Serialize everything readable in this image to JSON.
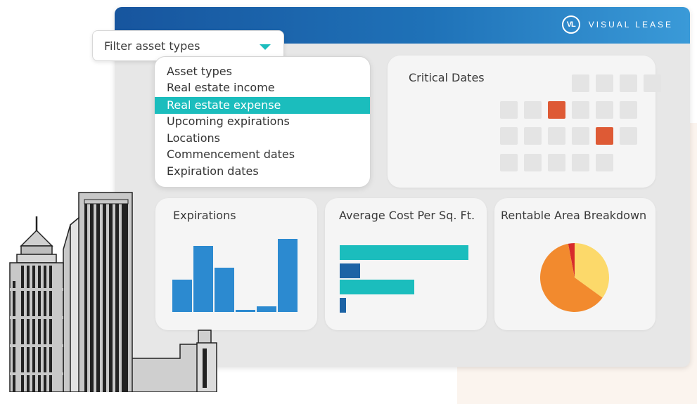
{
  "header": {
    "logo_text": "VL",
    "brand_name": "VISUAL LEASE"
  },
  "filter": {
    "label": "Filter asset types",
    "options": [
      "Asset types",
      "Real estate income",
      "Real estate expense",
      "Upcoming expirations",
      "Locations",
      "Commencement dates",
      "Expiration dates"
    ],
    "selected": "Real estate expense"
  },
  "critical_dates": {
    "title": "Critical Dates",
    "highlighted_cells": 2
  },
  "expirations": {
    "title": "Expirations"
  },
  "avg_cost": {
    "title": "Average Cost Per Sq. Ft."
  },
  "rentable_area": {
    "title": "Rentable Area Breakdown"
  },
  "colors": {
    "accent_teal": "#1bbdbd",
    "header_blue": "#1f72b8",
    "highlight_red": "#de5a35",
    "bar_blue": "#2c8ad0",
    "bar_dark_blue": "#1c63a5",
    "pie_orange": "#f28a2e",
    "pie_yellow": "#fcd96a",
    "pie_red": "#d72b2b"
  },
  "chart_data": [
    {
      "type": "bar",
      "title": "Expirations",
      "values": [
        46,
        94,
        63,
        3,
        8,
        104
      ]
    },
    {
      "type": "bar",
      "orientation": "horizontal",
      "title": "Average Cost Per Sq. Ft.",
      "values": [
        183,
        29,
        106,
        9
      ]
    },
    {
      "type": "pie",
      "title": "Rentable Area Breakdown",
      "values": [
        62,
        35,
        3
      ]
    }
  ]
}
